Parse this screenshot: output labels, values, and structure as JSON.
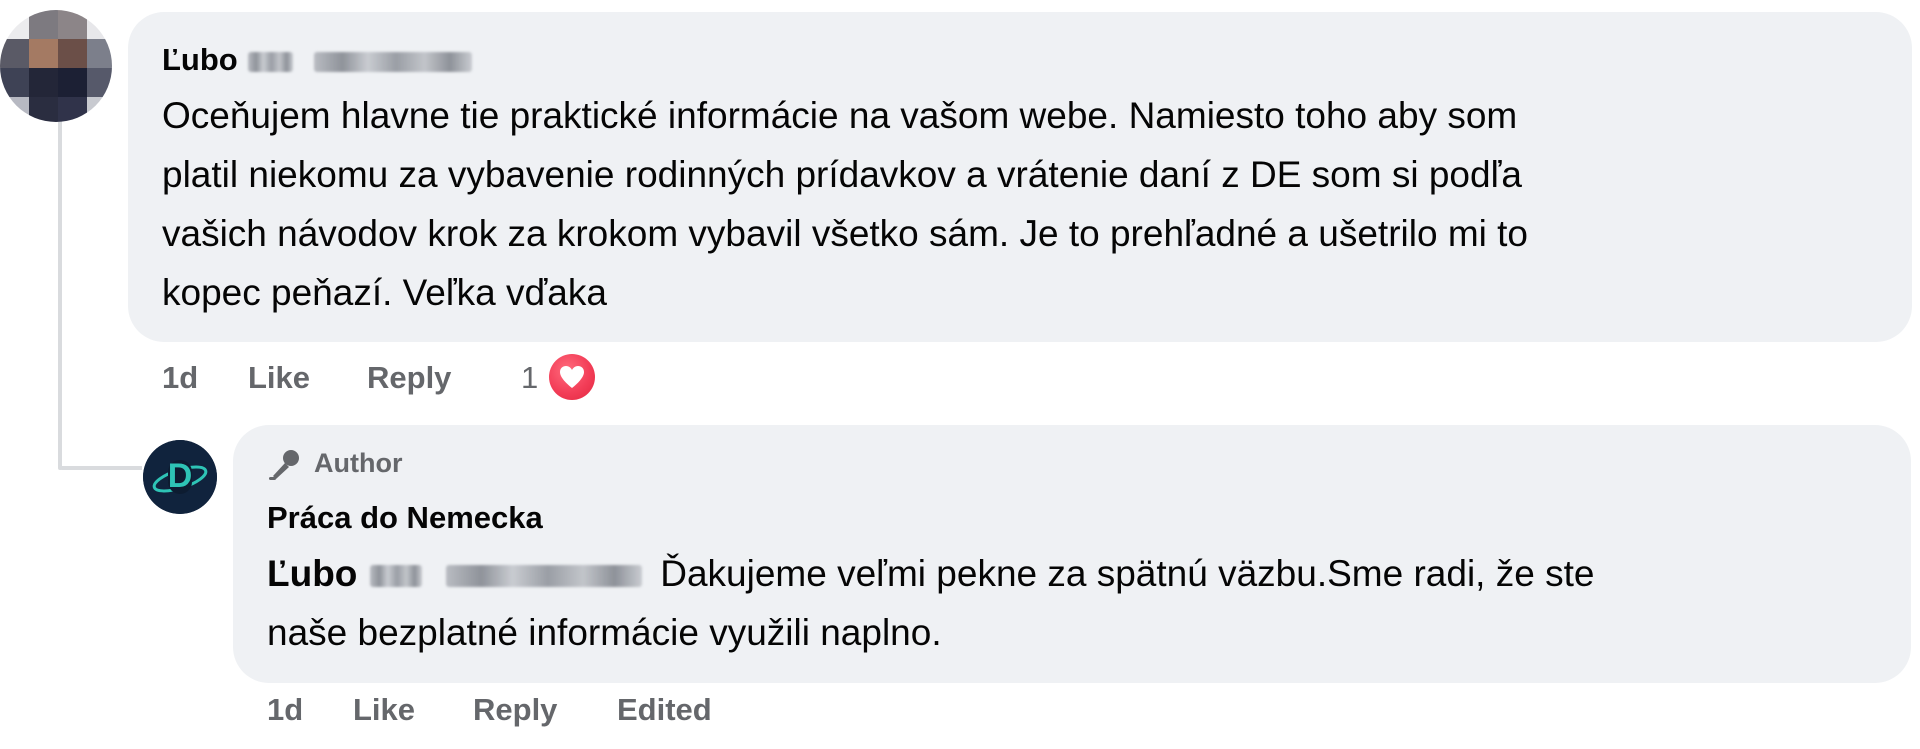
{
  "comment": {
    "author_visible": "Ľubo",
    "text_lines": [
      "Oceňujem hlavne tie praktické informácie na vašom webe. Namiesto toho aby som",
      "platil niekomu za vybavenie rodinných prídavkov a vrátenie daní z DE som si podľa",
      "vašich návodov krok za krokom vybavil všetko sám. Je to prehľadné a ušetrilo mi to",
      "kopec peňazí. Veľka vďaka"
    ],
    "meta": {
      "time": "1d",
      "like_label": "Like",
      "reply_label": "Reply",
      "reaction_count": "1",
      "reaction_icon": "heart-icon"
    }
  },
  "reply": {
    "badge_label": "Author",
    "badge_icon": "microphone-icon",
    "author": "Práca do Nemecka",
    "avatar_letter": "D",
    "mention_visible": "Ľubo",
    "text_line1": "Ďakujeme veľmi pekne za spätnú väzbu.Sme radi, že ste",
    "text_line2": "naše bezplatné informácie využili naplno.",
    "meta": {
      "time": "1d",
      "like_label": "Like",
      "reply_label": "Reply",
      "edited_label": "Edited"
    }
  },
  "colors": {
    "bubble": "#eff1f4",
    "meta_text": "#65676b",
    "heart": "#f33e58",
    "page_avatar_bg": "#10233d",
    "page_avatar_accent": "#2ec4b6"
  }
}
